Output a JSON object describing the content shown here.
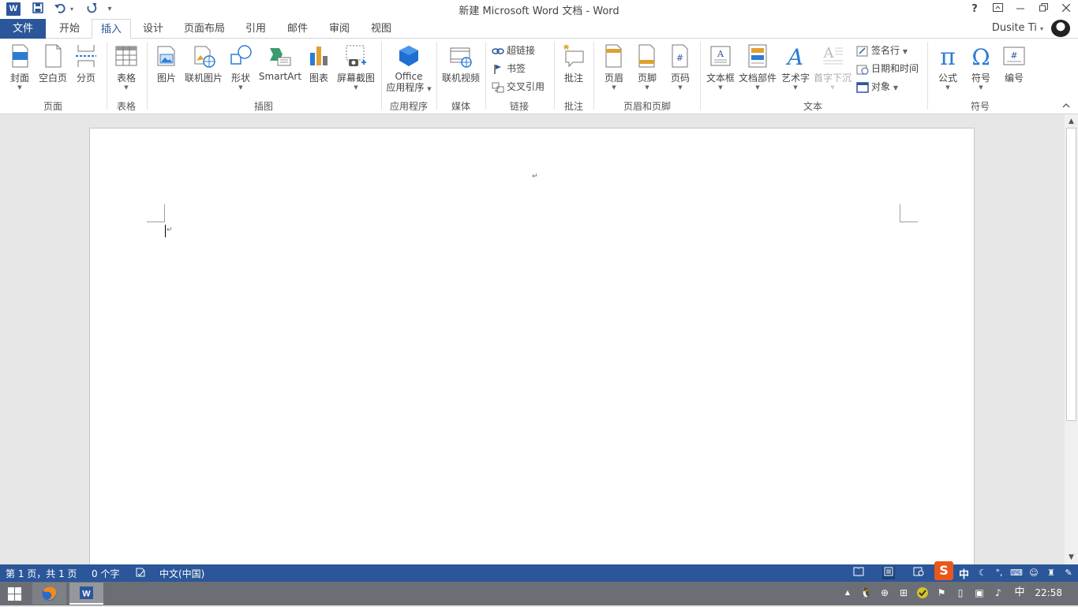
{
  "titlebar": {
    "app_icon": "word-icon",
    "title": "新建 Microsoft Word 文档 - Word",
    "help": "?",
    "qa_icons": [
      "save-icon",
      "undo-icon",
      "undo-dropdown-icon",
      "redo-icon",
      "customize-qa-icon"
    ],
    "window_controls": [
      "ribbon-display-icon",
      "minimize-icon",
      "restore-icon",
      "close-icon"
    ]
  },
  "tabs": {
    "file": "文件",
    "items": [
      "开始",
      "插入",
      "设计",
      "页面布局",
      "引用",
      "邮件",
      "审阅",
      "视图"
    ],
    "active": "插入",
    "user": "Dusite Ti"
  },
  "ribbon": {
    "pages": {
      "cover": "封面",
      "blank": "空白页",
      "break": "分页",
      "group": "页面"
    },
    "tables": {
      "table": "表格",
      "group": "表格"
    },
    "illustrations": {
      "picture": "图片",
      "online_picture": "联机图片",
      "shapes": "形状",
      "smartart": "SmartArt",
      "chart": "图表",
      "screenshot": "屏幕截图",
      "group": "插图"
    },
    "apps": {
      "office_line1": "Office",
      "office_line2": "应用程序",
      "group": "应用程序"
    },
    "media": {
      "online_video": "联机视频",
      "group": "媒体"
    },
    "links": {
      "hyperlink": "超链接",
      "bookmark": "书签",
      "crossref": "交叉引用",
      "group": "链接"
    },
    "comments": {
      "comment": "批注",
      "group": "批注"
    },
    "header_footer": {
      "header": "页眉",
      "footer": "页脚",
      "page_number": "页码",
      "group": "页眉和页脚"
    },
    "text": {
      "textbox": "文本框",
      "quickparts": "文档部件",
      "wordart": "艺术字",
      "dropcap": "首字下沉",
      "signature": "签名行",
      "datetime": "日期和时间",
      "object": "对象",
      "group": "文本"
    },
    "symbols": {
      "equation": "公式",
      "symbol": "符号",
      "number": "编号",
      "group": "符号"
    }
  },
  "document": {
    "paragraph_mark": "↵"
  },
  "status": {
    "page": "第 1 页，共 1 页",
    "words": "0 个字",
    "language": "中文(中国)"
  },
  "ime": {
    "mode": "中"
  },
  "taskbar": {
    "ime": "中",
    "time": "22:58"
  },
  "colors": {
    "accent": "#2b579a",
    "taskbar": "#6b6f75"
  }
}
